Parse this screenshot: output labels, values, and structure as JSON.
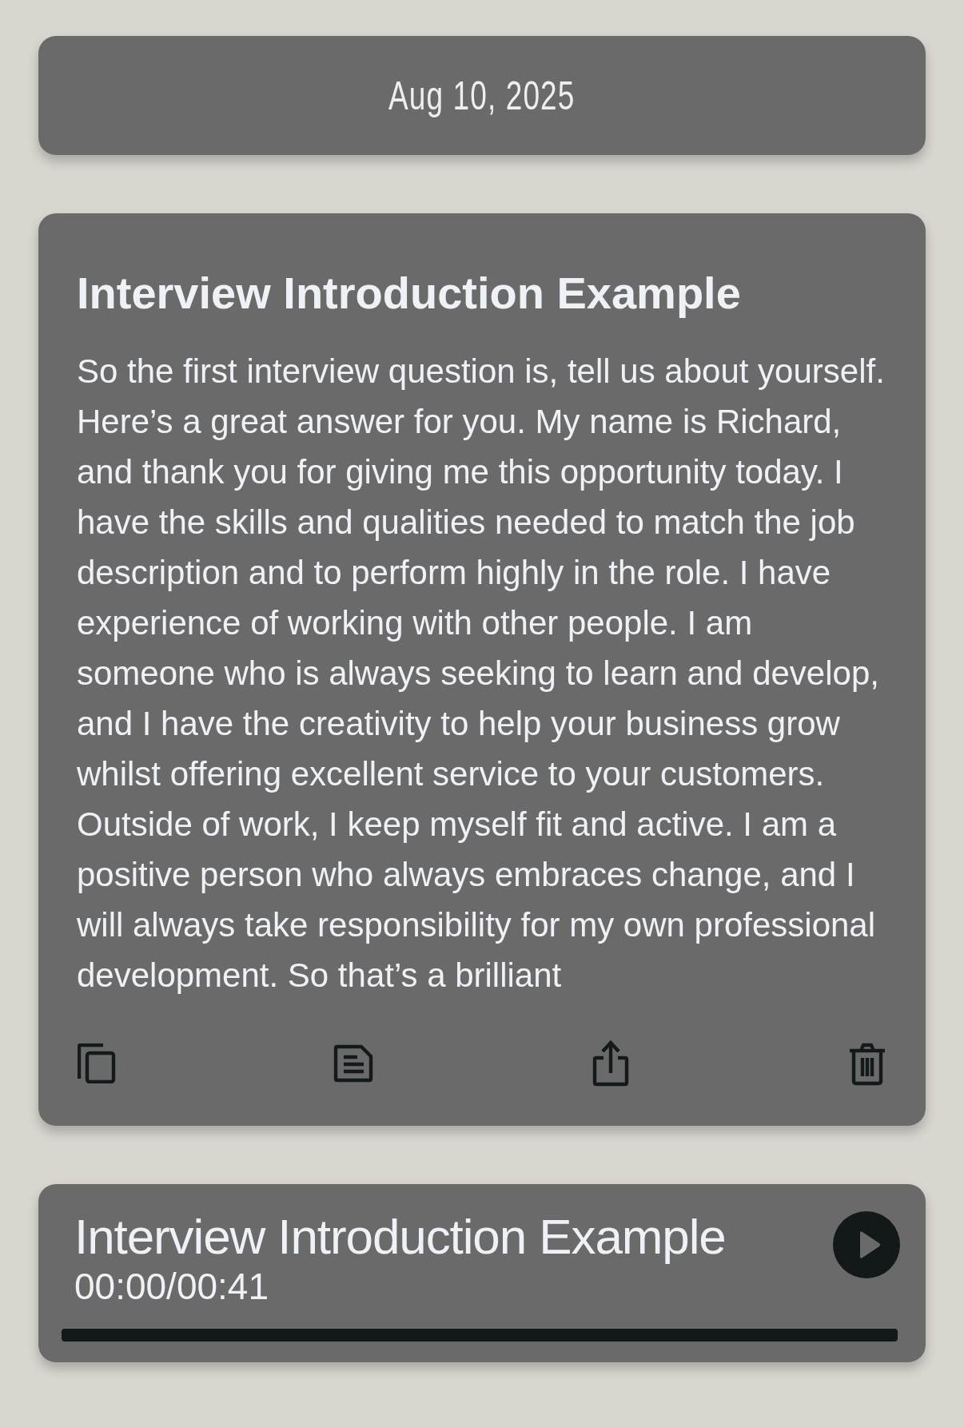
{
  "date_header": {
    "label": "Aug 10, 2025"
  },
  "note": {
    "title": "Interview Introduction Example",
    "body": "So the first interview question is, tell us about yourself. Here’s a great answer for you. My name is Richard, and thank you for giving me this opportunity today. I have the skills and qualities needed to match the job description and to perform highly in the role. I have experience of working with other people. I am someone who is always seeking to learn and develop, and I have the creativity to help your business grow whilst offering excellent service to your customers. Outside of work, I keep myself fit and active. I am a positive person who always embraces change, and I will always take responsibility for my own professional development. So that’s a brilliant",
    "actions": [
      {
        "kind": "copy"
      },
      {
        "kind": "document"
      },
      {
        "kind": "share"
      },
      {
        "kind": "delete"
      }
    ]
  },
  "player": {
    "title": "Interview Introduction Example",
    "time": "00:00/00:41",
    "playing": false
  }
}
